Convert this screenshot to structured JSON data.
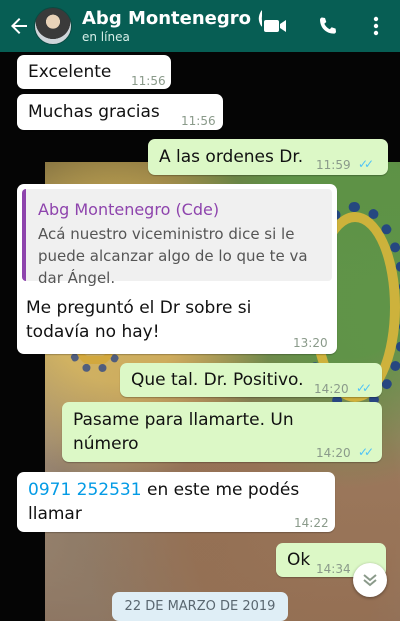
{
  "header": {
    "contact_name": "Abg Montenegro (...",
    "status": "en línea",
    "icons": [
      "back-arrow-icon",
      "avatar",
      "video-call-icon",
      "phone-icon",
      "more-options-icon"
    ]
  },
  "messages": [
    {
      "direction": "incoming",
      "text": "Excelente",
      "time": "11:56"
    },
    {
      "direction": "incoming",
      "text": "Muchas gracias",
      "time": "11:56"
    },
    {
      "direction": "outgoing",
      "text": "A las ordenes Dr.",
      "time": "11:59",
      "read": true
    },
    {
      "direction": "incoming",
      "quote": {
        "author": "Abg Montenegro (Cde)",
        "lines": [
          "Acá nuestro viceministro dice si le",
          "puede alcanzar algo de lo que te va",
          "dar Ángel."
        ]
      },
      "lines": [
        "Me preguntó el Dr sobre si",
        "todavía no hay!"
      ],
      "time": "13:20"
    },
    {
      "direction": "outgoing",
      "text": "Que tal. Dr. Positivo.",
      "time": "14:20",
      "read": true
    },
    {
      "direction": "outgoing",
      "lines": [
        "Pasame para llamarte. Un",
        "número"
      ],
      "time": "14:20",
      "read": true
    },
    {
      "direction": "incoming",
      "link": "0971 252531",
      "text_after": " en este me podés",
      "line2": "llamar",
      "time": "14:22"
    },
    {
      "direction": "outgoing",
      "text": "Ok",
      "time": "14:34",
      "read": true
    }
  ],
  "date_separator": "22 DE MARZO DE 2019",
  "colors": {
    "header": "#075e54",
    "outgoing_bubble": "#dcf8c6",
    "incoming_bubble": "#ffffff",
    "read_ticks": "#4fc3f7",
    "quote_accent": "#8e44ad",
    "link": "#039be5"
  }
}
